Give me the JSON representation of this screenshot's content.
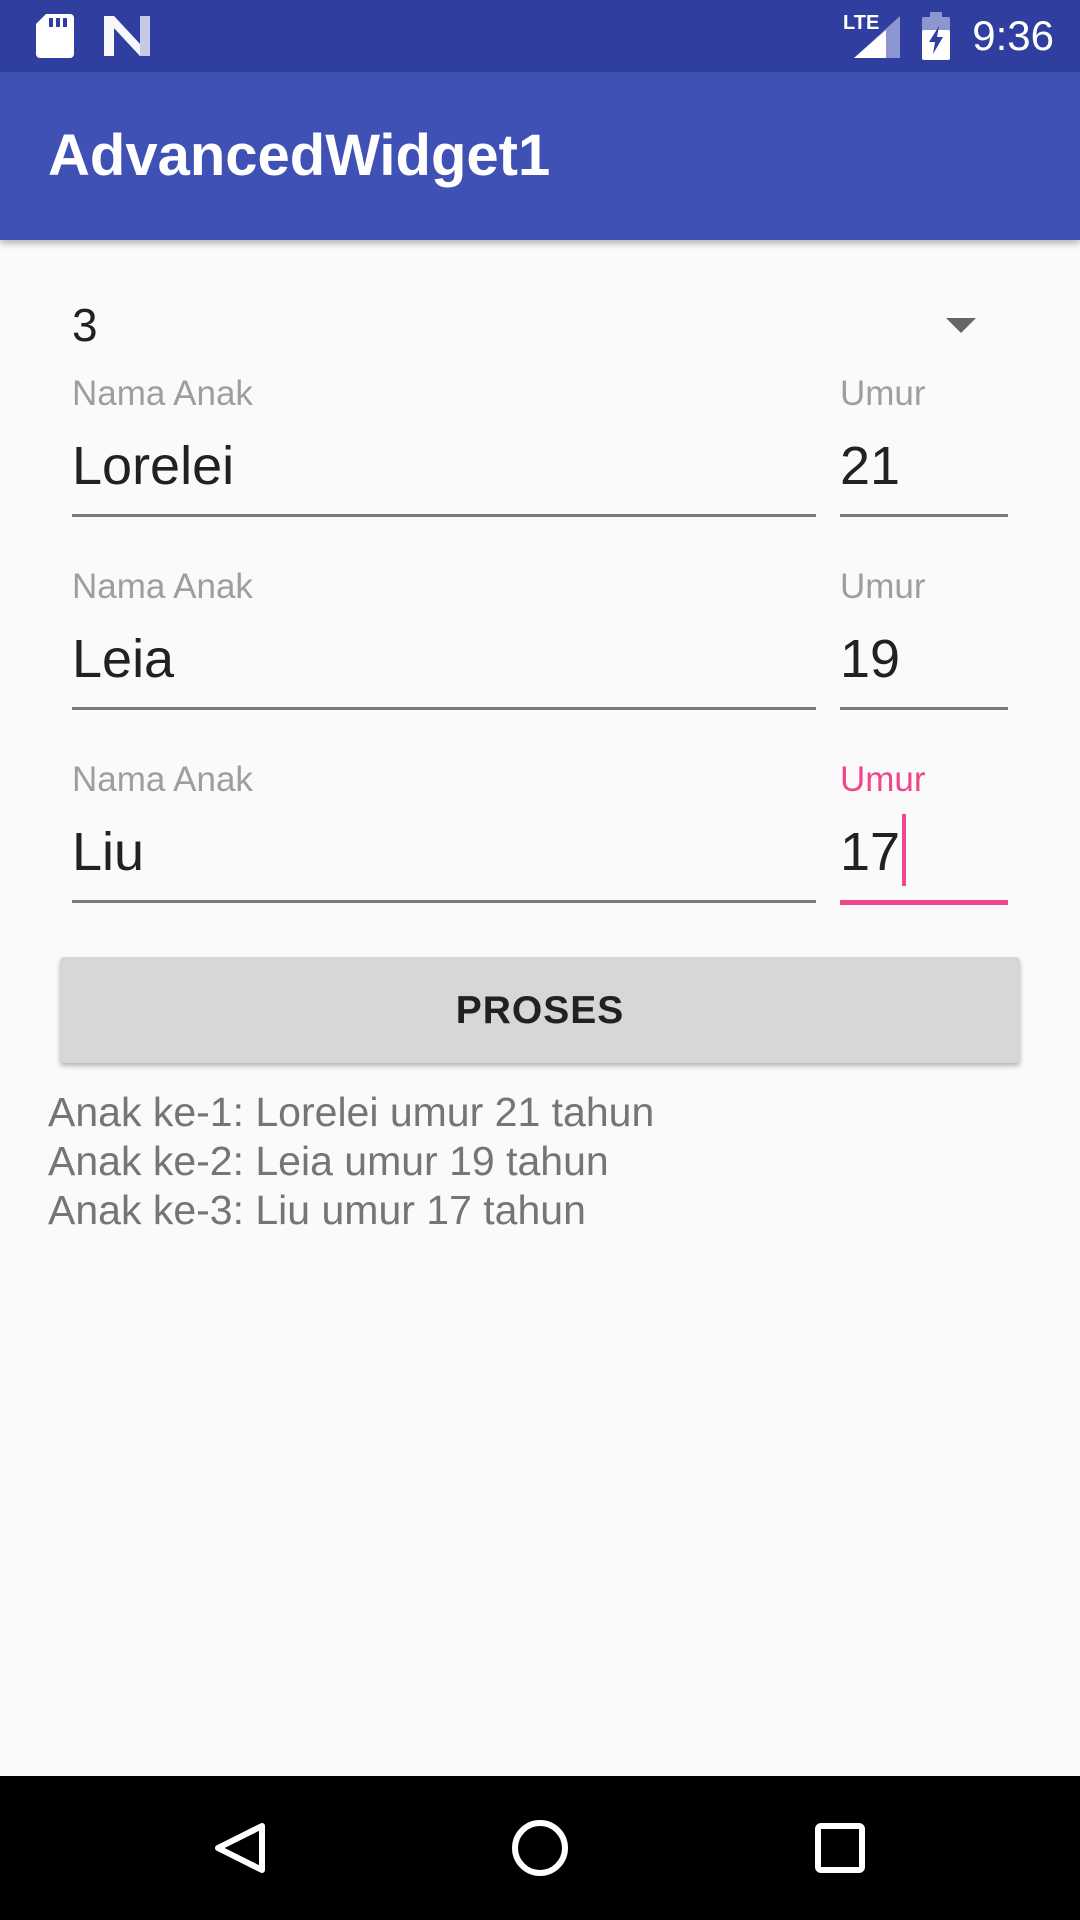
{
  "status_bar": {
    "time": "9:36",
    "network_label": "LTE",
    "icons": [
      "sd-card-icon",
      "n-logo-icon",
      "lte-signal-icon",
      "battery-charging-icon"
    ],
    "color": "#303F9F"
  },
  "app_bar": {
    "title": "AdvancedWidget1",
    "color": "#3F51B5"
  },
  "spinner": {
    "selected_value": "3"
  },
  "children": [
    {
      "name_label": "Nama Anak",
      "name_value": "Lorelei",
      "age_label": "Umur",
      "age_value": "21"
    },
    {
      "name_label": "Nama Anak",
      "name_value": "Leia",
      "age_label": "Umur",
      "age_value": "19"
    },
    {
      "name_label": "Nama Anak",
      "name_value": "Liu",
      "age_label": "Umur",
      "age_value": "17"
    }
  ],
  "focused_field": "children.2.age",
  "accent_color": "#F0468A",
  "button": {
    "label": "PROSES"
  },
  "output": {
    "lines": [
      "Anak ke-1: Lorelei umur 21 tahun",
      "Anak ke-2: Leia umur 19 tahun",
      "Anak ke-3: Liu umur 17 tahun"
    ]
  },
  "nav_bar": {
    "buttons": [
      "back-icon",
      "home-icon",
      "recents-icon"
    ]
  }
}
